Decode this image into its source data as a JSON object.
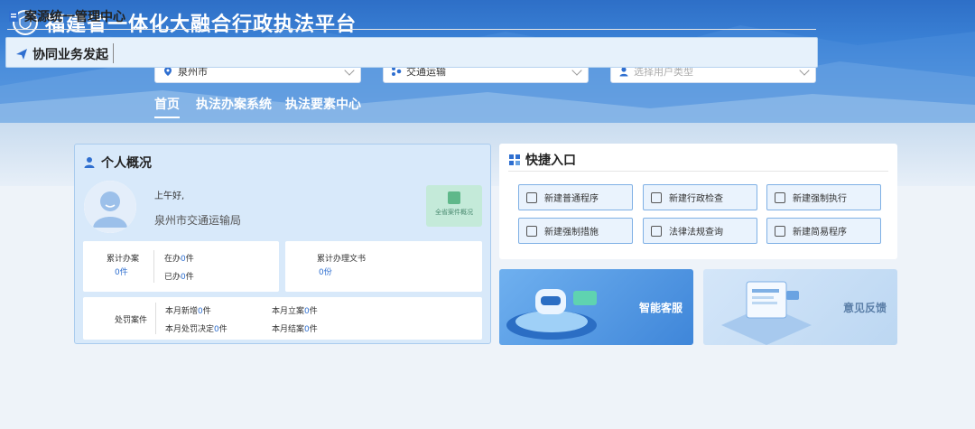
{
  "header": {
    "title": "福建省一体化大融合行政执法平台",
    "selects": {
      "city": {
        "value": "泉州市",
        "icon": "location-pin-icon"
      },
      "department": {
        "value": "交通运输",
        "icon": "org-icon"
      },
      "user_type": {
        "placeholder": "选择用户类型",
        "icon": "user-icon"
      }
    },
    "nav": [
      {
        "label": "首页",
        "active": true
      },
      {
        "label": "执法办案系统",
        "active": false
      },
      {
        "label": "执法要素中心",
        "active": false
      }
    ]
  },
  "profile": {
    "title": "个人概况",
    "greeting": "上午好,",
    "org": "泉州市交通运输局",
    "all_cases_button": "全省案件概况",
    "stats": {
      "total_cases_label": "累计办案",
      "total_cases_value": "0件",
      "in_progress_label": "在办",
      "in_progress_value": "0",
      "in_progress_unit": "件",
      "done_label": "已办",
      "done_value": "0",
      "done_unit": "件",
      "docs_label": "累计办理文书",
      "docs_value": "0份",
      "penalty_label": "处罚案件",
      "month_new_label": "本月新增",
      "month_new_value": "0",
      "month_new_unit": "件",
      "month_filed_label": "本月立案",
      "month_filed_value": "0",
      "month_filed_unit": "件",
      "month_decision_label": "本月处罚决定",
      "month_decision_value": "0",
      "month_decision_unit": "件",
      "month_closed_label": "本月结案",
      "month_closed_value": "0",
      "month_closed_unit": "件"
    }
  },
  "quick": {
    "title": "快捷入口",
    "buttons": [
      {
        "label": "新建普通程序",
        "icon": "shield-check-icon"
      },
      {
        "label": "新建行政检查",
        "icon": "document-edit-icon"
      },
      {
        "label": "新建强制执行",
        "icon": "briefcase-icon"
      },
      {
        "label": "新建强制措施",
        "icon": "monitor-icon"
      },
      {
        "label": "法律法规查询",
        "icon": "scales-icon"
      },
      {
        "label": "新建简易程序",
        "icon": "document-icon"
      }
    ]
  },
  "tiles": {
    "service": "智能客服",
    "feedback": "意见反馈"
  },
  "case_center": {
    "title": "案源统一管理中心",
    "coop_title": "协同业务发起"
  },
  "colors": {
    "brand": "#2f6fd0",
    "banner": "#3b82d6",
    "accent_green": "#5fb88a"
  }
}
